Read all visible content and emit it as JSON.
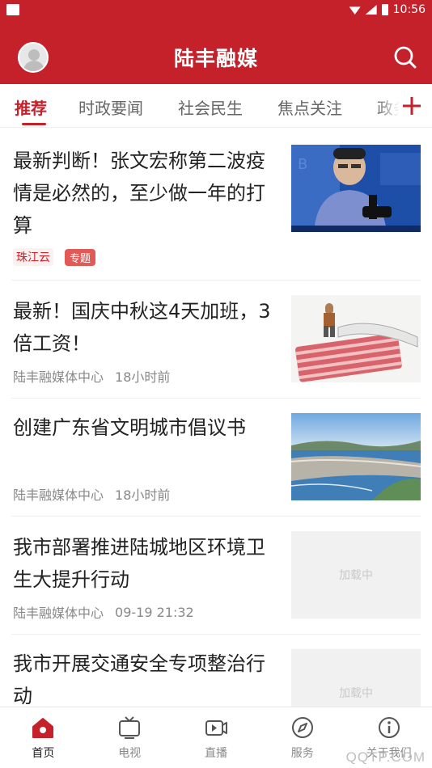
{
  "status_bar": {
    "time": "10:56"
  },
  "app_bar": {
    "title": "陆丰融媒"
  },
  "tabs": [
    {
      "label": "推荐",
      "active": true
    },
    {
      "label": "时政要闻"
    },
    {
      "label": "社会民生"
    },
    {
      "label": "焦点关注"
    },
    {
      "label": "政务"
    }
  ],
  "articles": [
    {
      "title": "最新判断！张文宏称第二波疫情是必然的，至少做一年的打算",
      "source_tag": "珠江云",
      "topic_tag": "专题",
      "image": "photo of speaker with microphone"
    },
    {
      "title": "最新！国庆中秋这4天加班，3倍工资！",
      "source": "陆丰融媒体中心",
      "time": "18小时前",
      "image": "photo of banknotes and figurine"
    },
    {
      "title": "创建广东省文明城市倡议书",
      "source": "陆丰融媒体中心",
      "time": "18小时前",
      "image": "aerial photo of coastal city"
    },
    {
      "title": "我市部署推进陆城地区环境卫生大提升行动",
      "source": "陆丰融媒体中心",
      "time": "09-19 21:32",
      "placeholder": "加载中"
    },
    {
      "title": "我市开展交通安全专项整治行动",
      "placeholder": "加载中"
    }
  ],
  "tabbar": [
    {
      "label": "首页",
      "icon": "home-icon",
      "active": true
    },
    {
      "label": "电视",
      "icon": "tv-icon"
    },
    {
      "label": "直播",
      "icon": "live-icon"
    },
    {
      "label": "服务",
      "icon": "compass-icon"
    },
    {
      "label": "关于我们",
      "icon": "info-icon"
    }
  ],
  "watermark": "QQTP.COM",
  "colors": {
    "brand_red": "#c4212a",
    "tag_red": "#e25a55"
  }
}
